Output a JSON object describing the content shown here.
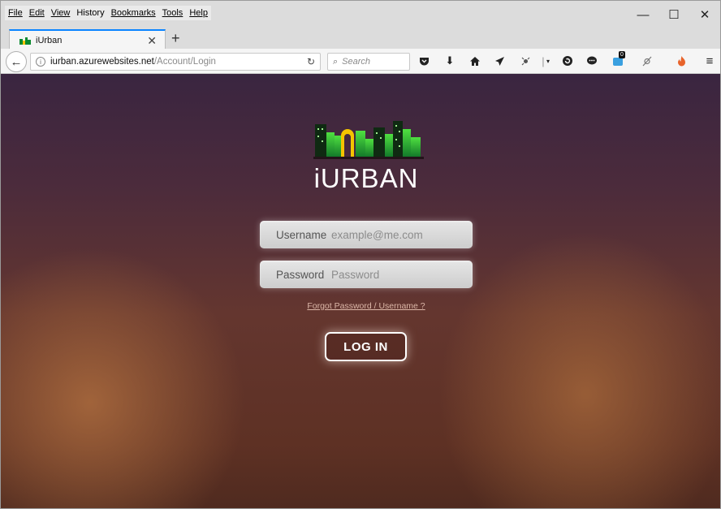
{
  "menu": {
    "file": "File",
    "edit": "Edit",
    "view": "View",
    "history": "History",
    "bookmarks": "Bookmarks",
    "tools": "Tools",
    "help": "Help"
  },
  "window_controls": {
    "minimize": "—",
    "maximize": "☐",
    "close": "✕"
  },
  "tab": {
    "title": "iUrban",
    "close": "✕",
    "new_tab": "+"
  },
  "url": {
    "host": "iurban.azurewebsites.net",
    "path": "/Account/Login"
  },
  "search": {
    "placeholder": "Search"
  },
  "toolbar": {
    "notification_count": "0"
  },
  "page": {
    "brand": "iURBAN",
    "username_label": "Username",
    "username_placeholder": "example@me.com",
    "password_label": "Password",
    "password_placeholder": "Password",
    "forgot_link": "Forgot Password / Username ?",
    "login_button": "LOG IN"
  },
  "colors": {
    "accent_tab": "#0a84ff",
    "logo_green": "#3fcf3a",
    "logo_yellow": "#f4c400",
    "background_top": "#3a2540",
    "background_bottom": "#5e3124"
  }
}
